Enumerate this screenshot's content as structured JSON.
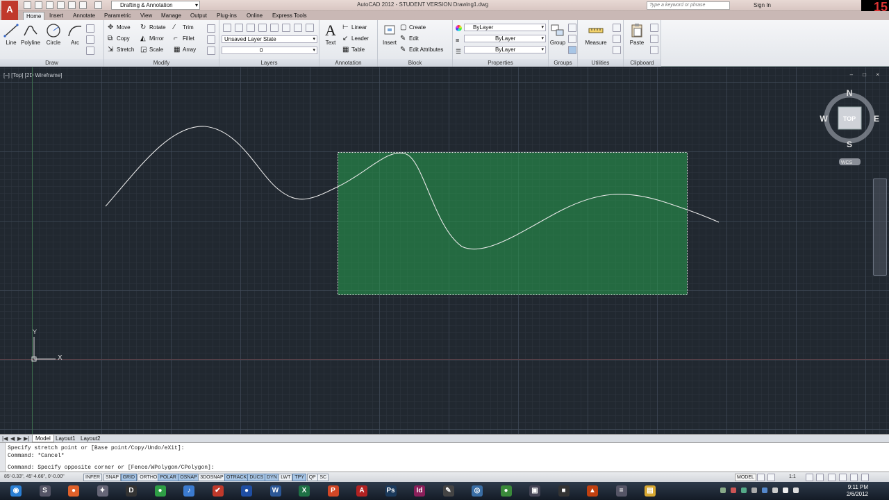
{
  "titlebar": {
    "workspace": "Drafting & Annotation",
    "title": "AutoCAD 2012 - STUDENT VERSION   Drawing1.dwg",
    "search_placeholder": "Type a keyword or phrase",
    "signin": "Sign In",
    "badge": "15"
  },
  "tabs": [
    "Home",
    "Insert",
    "Annotate",
    "Parametric",
    "View",
    "Manage",
    "Output",
    "Plug-ins",
    "Online",
    "Express Tools"
  ],
  "ribbon": {
    "draw": {
      "title": "Draw",
      "tools": [
        "Line",
        "Polyline",
        "Circle",
        "Arc"
      ]
    },
    "modify": {
      "title": "Modify",
      "tools": [
        "Move",
        "Rotate",
        "Trim",
        "Copy",
        "Mirror",
        "Fillet",
        "Stretch",
        "Scale",
        "Array"
      ]
    },
    "layers": {
      "title": "Layers",
      "layer_state": "Unsaved Layer State",
      "layer": "0"
    },
    "annotation": {
      "title": "Annotation",
      "text": "Text",
      "tools": [
        "Linear",
        "Leader",
        "Table"
      ]
    },
    "block": {
      "title": "Block",
      "insert": "Insert",
      "tools": [
        "Create",
        "Edit",
        "Edit Attributes"
      ]
    },
    "properties": {
      "title": "Properties",
      "color": "ByLayer",
      "linetype": "ByLayer",
      "lineweight": "ByLayer"
    },
    "groups": {
      "title": "Groups",
      "tool": "Group"
    },
    "utilities": {
      "title": "Utilities",
      "tool": "Measure"
    },
    "clipboard": {
      "title": "Clipboard",
      "tool": "Paste"
    }
  },
  "viewport": {
    "label": "[–] [Top] [2D Wireframe]",
    "controls": "– □ ×",
    "viewcube": {
      "face": "TOP",
      "n": "N",
      "s": "S",
      "e": "E",
      "w": "W",
      "wcs": "WCS"
    },
    "ucs": {
      "x": "X",
      "y": "Y"
    }
  },
  "layout_tabs": [
    "Model",
    "Layout1",
    "Layout2"
  ],
  "command_history": [
    "Specify stretch point or [Base point/Copy/Undo/eXit]:",
    "Command: *Cancel*",
    "Command: Specify opposite corner or [Fence/WPolygon/CPolygon]:"
  ],
  "statusbar": {
    "coords": "85'-0.33\",  45'-4.66\",  0'-0.00\"",
    "toggles": [
      {
        "label": "INFER",
        "on": false
      },
      {
        "label": "SNAP",
        "on": false
      },
      {
        "label": "GRID",
        "on": true
      },
      {
        "label": "ORTHO",
        "on": false
      },
      {
        "label": "POLAR",
        "on": true
      },
      {
        "label": "OSNAP",
        "on": true
      },
      {
        "label": "3DOSNAP",
        "on": false
      },
      {
        "label": "OTRACK",
        "on": true
      },
      {
        "label": "DUCS",
        "on": true
      },
      {
        "label": "DYN",
        "on": true
      },
      {
        "label": "LWT",
        "on": false
      },
      {
        "label": "TPY",
        "on": true
      },
      {
        "label": "QP",
        "on": false
      },
      {
        "label": "SC",
        "on": false
      }
    ],
    "model": "MODEL",
    "scale": "1:1"
  },
  "taskbar": {
    "time": "9:11 PM",
    "date": "2/6/2012",
    "apps": [
      {
        "name": "start",
        "glyph": "◉",
        "color": "#2a7fd4"
      },
      {
        "name": "steam",
        "glyph": "S",
        "color": "#556"
      },
      {
        "name": "origin",
        "glyph": "●",
        "color": "#e0612a"
      },
      {
        "name": "tools",
        "glyph": "✦",
        "color": "#667"
      },
      {
        "name": "dropbox",
        "glyph": "D",
        "color": "#333"
      },
      {
        "name": "chrome",
        "glyph": "●",
        "color": "#2e9e45"
      },
      {
        "name": "itunes",
        "glyph": "♪",
        "color": "#3b7bd0"
      },
      {
        "name": "checklist",
        "glyph": "✔",
        "color": "#c0392b"
      },
      {
        "name": "firefox",
        "glyph": "●",
        "color": "#1f4ea3"
      },
      {
        "name": "word",
        "glyph": "W",
        "color": "#2b5797"
      },
      {
        "name": "excel",
        "glyph": "X",
        "color": "#1e7145"
      },
      {
        "name": "powerpoint",
        "glyph": "P",
        "color": "#d24726"
      },
      {
        "name": "autocad",
        "glyph": "A",
        "color": "#b22222"
      },
      {
        "name": "photoshop",
        "glyph": "Ps",
        "color": "#1b3a5c"
      },
      {
        "name": "indesign",
        "glyph": "Id",
        "color": "#8b1f5a"
      },
      {
        "name": "pen",
        "glyph": "✎",
        "color": "#444"
      },
      {
        "name": "magnifier",
        "glyph": "◎",
        "color": "#3a6ea5"
      },
      {
        "name": "globe",
        "glyph": "●",
        "color": "#3a8a3a"
      },
      {
        "name": "media",
        "glyph": "▣",
        "color": "#445"
      },
      {
        "name": "camera",
        "glyph": "■",
        "color": "#333"
      },
      {
        "name": "vlc",
        "glyph": "▲",
        "color": "#c04010"
      },
      {
        "name": "calculator",
        "glyph": "=",
        "color": "#556"
      },
      {
        "name": "folder",
        "glyph": "▤",
        "color": "#d8a831"
      }
    ]
  }
}
